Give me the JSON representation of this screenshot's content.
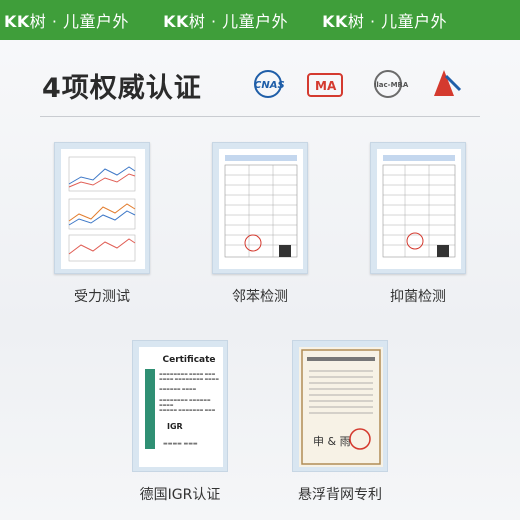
{
  "header": {
    "brand_kk": "KK",
    "brand_tail": "树 · 儿童户外"
  },
  "section": {
    "title": "4项权威认证"
  },
  "logos": [
    {
      "name": "cnas-logo",
      "label": "CNAS"
    },
    {
      "name": "cma-logo",
      "label": "MA"
    },
    {
      "name": "ilac-mra-logo",
      "label": "ilac-MRA"
    },
    {
      "name": "flag-icon",
      "label": ""
    }
  ],
  "certificates": [
    {
      "name": "force-test",
      "caption": "受力测试"
    },
    {
      "name": "phenol-test",
      "caption": "邻苯检测"
    },
    {
      "name": "antibacterial-test",
      "caption": "抑菌检测"
    },
    {
      "name": "igr-cert",
      "caption": "德国IGR认证"
    },
    {
      "name": "patent-cert",
      "caption": "悬浮背网专利"
    }
  ],
  "igr_card": {
    "title": "Certificate",
    "side": "Ergonomic Product",
    "logo": "IGR"
  },
  "colors": {
    "accent": "#3f9e3a"
  }
}
